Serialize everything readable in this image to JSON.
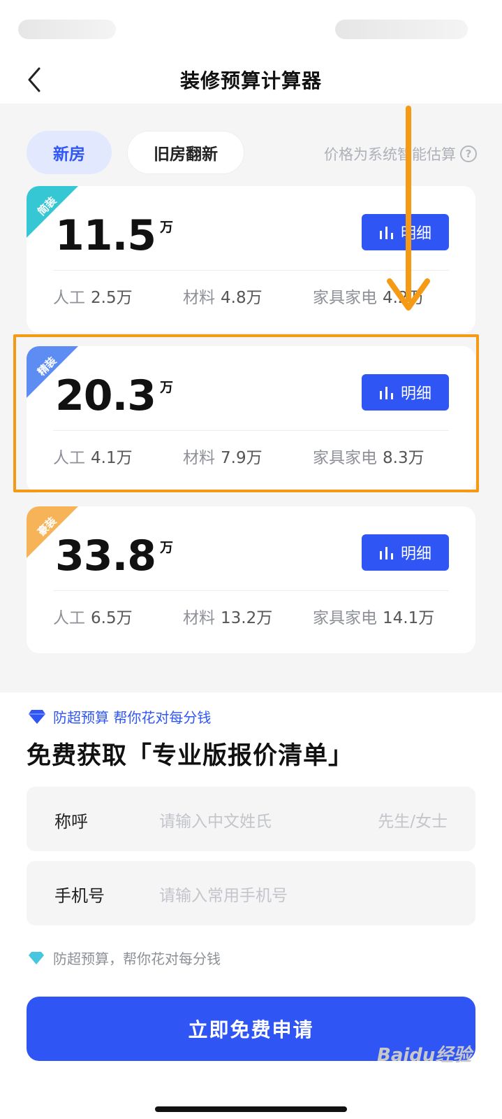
{
  "nav": {
    "title": "装修预算计算器"
  },
  "tabs": [
    {
      "label": "新房",
      "active": true
    },
    {
      "label": "旧房翻新",
      "active": false
    }
  ],
  "hint": "价格为系统智能估算",
  "cards": [
    {
      "tag": "简装",
      "tag_color": "#36c7d5",
      "price": "11.5",
      "unit": "万",
      "detail_label": "明细",
      "labor_label": "人工",
      "labor": "2.5万",
      "material_label": "材料",
      "material": "4.8万",
      "furniture_label": "家具家电",
      "furniture": "4.2万"
    },
    {
      "tag": "精装",
      "tag_color": "#5d8df3",
      "price": "20.3",
      "unit": "万",
      "detail_label": "明细",
      "labor_label": "人工",
      "labor": "4.1万",
      "material_label": "材料",
      "material": "7.9万",
      "furniture_label": "家具家电",
      "furniture": "8.3万"
    },
    {
      "tag": "豪装",
      "tag_color": "#f6b357",
      "price": "33.8",
      "unit": "万",
      "detail_label": "明细",
      "labor_label": "人工",
      "labor": "6.5万",
      "material_label": "材料",
      "material": "13.2万",
      "furniture_label": "家具家电",
      "furniture": "14.1万"
    }
  ],
  "form": {
    "promo": "防超预算 帮你花对每分钱",
    "title": "免费获取「专业版报价清单」",
    "name_label": "称呼",
    "name_placeholder": "请输入中文姓氏",
    "gender": "先生/女士",
    "phone_label": "手机号",
    "phone_placeholder": "请输入常用手机号",
    "promo2": "防超预算，帮你花对每分钱",
    "submit": "立即免费申请"
  },
  "watermark": "Baidu经验",
  "colors": {
    "accent": "#2f56f5",
    "highlight": "#f59a14",
    "background": "#f5f5f6"
  }
}
